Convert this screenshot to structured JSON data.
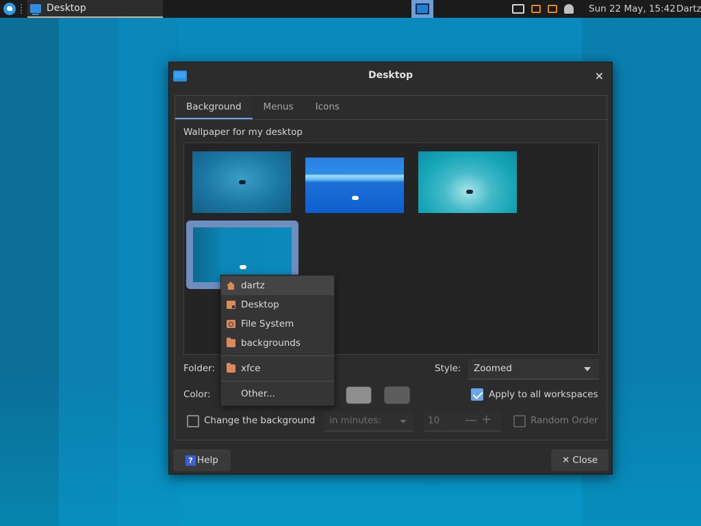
{
  "panel": {
    "task_label": "Desktop",
    "clock": "Sun 22 May, 15:42",
    "user": "Dartz"
  },
  "dialog": {
    "title": "Desktop",
    "close_glyph": "×",
    "tabs": [
      "Background",
      "Menus",
      "Icons"
    ],
    "active_tab": "Background",
    "wallpaper_label": "Wallpaper for my desktop",
    "folder_label": "Folder:",
    "style_label": "Style:",
    "style_value": "Zoomed",
    "color_label": "Color:",
    "colors": [
      "#8e8e8e",
      "#5d5d5d"
    ],
    "apply_all_label": "Apply to all workspaces",
    "apply_all_checked": true,
    "change_bg_label": "Change the background",
    "change_bg_checked": false,
    "interval_placeholder": "in minutes:",
    "interval_value": "10",
    "spin_minus": "—",
    "spin_plus": "+",
    "random_order_label": "Random Order",
    "random_order_checked": false,
    "help_label": "Help",
    "help_glyph": "?",
    "close_label": "Close",
    "close_btn_glyph": "✕"
  },
  "folder_menu": {
    "items": [
      "dartz",
      "Desktop",
      "File System",
      "backgrounds",
      "xfce",
      "Other..."
    ]
  }
}
